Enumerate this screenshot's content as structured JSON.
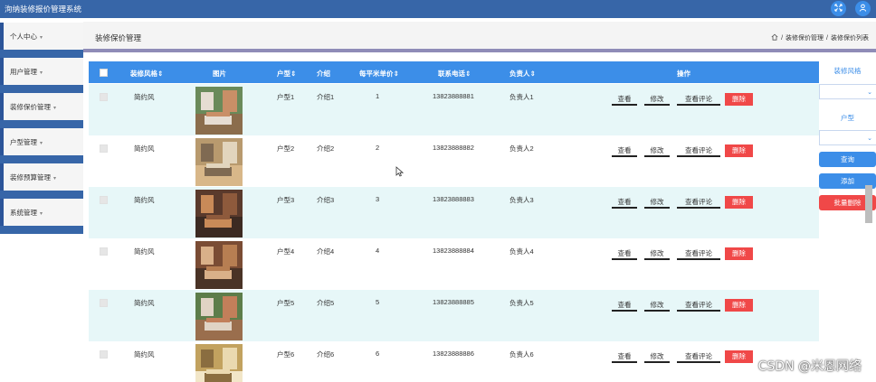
{
  "app": {
    "title": "洵纳装修报价管理系统"
  },
  "topbar": {
    "fullscreen_icon": "expand-icon",
    "user_icon": "user-icon"
  },
  "sidebar": {
    "items": [
      {
        "label": "个人中心"
      },
      {
        "label": "用户管理"
      },
      {
        "label": "装修保价管理"
      },
      {
        "label": "户型管理"
      },
      {
        "label": "装修预算管理"
      },
      {
        "label": "系统管理"
      }
    ]
  },
  "header": {
    "title": "装修保价管理",
    "breadcrumb": [
      "装修保价管理",
      "装修保价列表"
    ],
    "separator": "/"
  },
  "table": {
    "columns": {
      "style": "装修风格⇕",
      "image": "图片",
      "house_type": "户型⇕",
      "intro": "介绍",
      "price": "每平米单价⇕",
      "phone": "联系电话⇕",
      "owner": "负责人⇕",
      "actions": "操作"
    },
    "rows": [
      {
        "style": "简约风",
        "house_type": "户型1",
        "intro": "介绍1",
        "price": "1",
        "phone": "13823888881",
        "owner": "负责人1"
      },
      {
        "style": "简约风",
        "house_type": "户型2",
        "intro": "介绍2",
        "price": "2",
        "phone": "13823888882",
        "owner": "负责人2"
      },
      {
        "style": "简约风",
        "house_type": "户型3",
        "intro": "介绍3",
        "price": "3",
        "phone": "13823888883",
        "owner": "负责人3"
      },
      {
        "style": "简约风",
        "house_type": "户型4",
        "intro": "介绍4",
        "price": "4",
        "phone": "13823888884",
        "owner": "负责人4"
      },
      {
        "style": "简约风",
        "house_type": "户型5",
        "intro": "介绍5",
        "price": "5",
        "phone": "13823888885",
        "owner": "负责人5"
      },
      {
        "style": "简约风",
        "house_type": "户型6",
        "intro": "介绍6",
        "price": "6",
        "phone": "13823888886",
        "owner": "负责人6"
      }
    ],
    "actions": {
      "view": "查看",
      "edit": "修改",
      "comments": "查看评论",
      "delete": "删除"
    }
  },
  "filters": {
    "style_label": "装修风格",
    "house_type_label": "户型",
    "search_button": "查询",
    "add_button": "添加",
    "batch_delete_button": "批量删除"
  },
  "watermark": "CSDN @米恩网络",
  "colors": {
    "primary": "#3c8ee8",
    "topbar": "#3766a8",
    "danger": "#f04848",
    "row_alt": "#e7f7f8"
  }
}
